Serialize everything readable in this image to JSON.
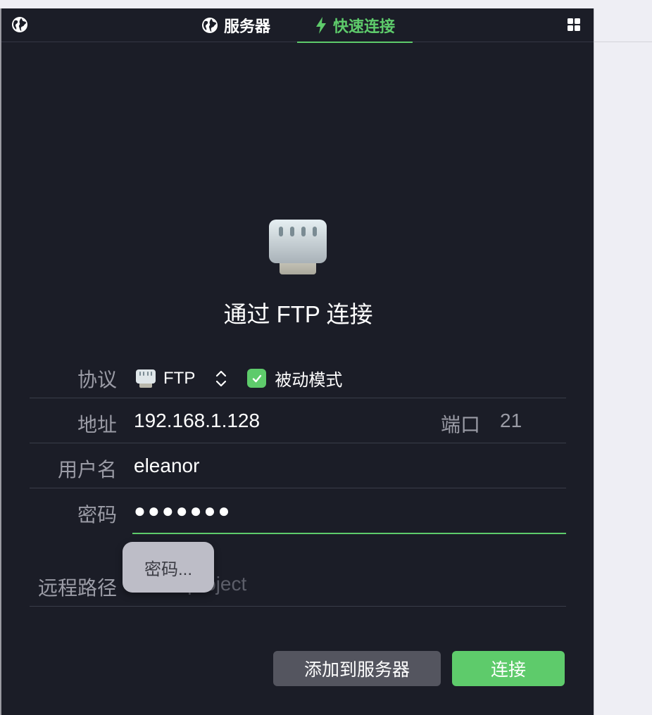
{
  "toolbar": {
    "tabs": [
      {
        "label": "服务器",
        "icon": "globe-icon",
        "active": false
      },
      {
        "label": "快速连接",
        "icon": "bolt-icon",
        "active": true
      }
    ],
    "accent_color": "#5ecb6b"
  },
  "hero": {
    "icon": "ethernet-port-icon",
    "title": "通过 FTP 连接"
  },
  "form": {
    "protocol": {
      "label": "协议",
      "value": "FTP",
      "passive_mode_label": "被动模式",
      "passive_mode_checked": true
    },
    "address": {
      "label": "地址",
      "value": "192.168.1.128",
      "port_label": "端口",
      "port_value": "21"
    },
    "username": {
      "label": "用户名",
      "value": "eleanor"
    },
    "password": {
      "label": "密码",
      "value": "●●●●●●●",
      "tooltip": "密码..."
    },
    "remote_path": {
      "label": "远程路径",
      "placeholder": "/www/project"
    }
  },
  "buttons": {
    "add_to_servers": "添加到服务器",
    "connect": "连接"
  }
}
